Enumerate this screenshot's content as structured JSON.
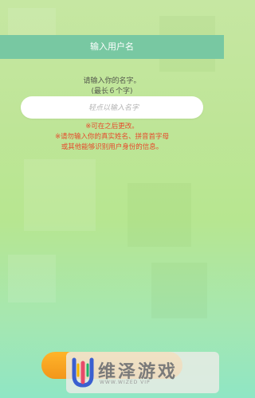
{
  "header": {
    "title": "输入用户名"
  },
  "prompt": {
    "line1": "请输入你的名字。",
    "line2": "(最长６个字)"
  },
  "input": {
    "placeholder": "轻点以输入名字",
    "value": ""
  },
  "notes": {
    "line1": "※可在之后更改。",
    "line2": "※请勿输入你的真实姓名、拼音首字母",
    "line3": "或其他能够识别用户身份的信息。"
  },
  "watermark": {
    "title": "维泽游戏",
    "subtitle": "WWW.WIZED VIP"
  },
  "colors": {
    "header": "#78c8a2",
    "note": "#e64a2c",
    "button": "#f2961a"
  }
}
